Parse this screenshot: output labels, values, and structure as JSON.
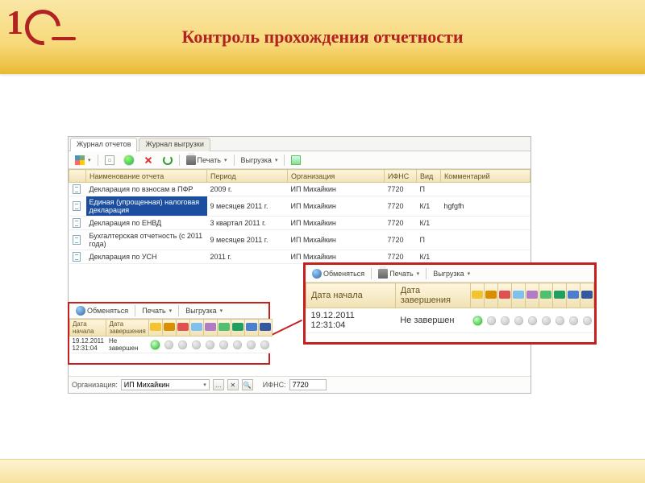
{
  "slide": {
    "title": "Контроль прохождения отчетности"
  },
  "tabs": {
    "reports": "Журнал отчетов",
    "uploads": "Журнал выгрузки"
  },
  "toolbar": {
    "print": "Печать",
    "export": "Выгрузка"
  },
  "grid": {
    "headers": {
      "name": "Наименование отчета",
      "period": "Период",
      "org": "Организация",
      "ifns": "ИФНС",
      "kind": "Вид",
      "comment": "Комментарий"
    },
    "rows": [
      {
        "name": "Декларация по взносам в ПФР",
        "period": "2009 г.",
        "org": "ИП Михайкин",
        "ifns": "7720",
        "kind": "П",
        "comment": ""
      },
      {
        "name": "Единая (упрощенная) налоговая декларация",
        "period": "9 месяцев 2011 г.",
        "org": "ИП Михайкин",
        "ifns": "7720",
        "kind": "К/1",
        "comment": "hgfgfh"
      },
      {
        "name": "Декларация по ЕНВД",
        "period": "3 квартал 2011 г.",
        "org": "ИП Михайкин",
        "ifns": "7720",
        "kind": "К/1",
        "comment": ""
      },
      {
        "name": "Бухгалтерская отчетность (с 2011 года)",
        "period": "9 месяцев 2011 г.",
        "org": "ИП Михайкин",
        "ifns": "7720",
        "kind": "П",
        "comment": ""
      },
      {
        "name": "Декларация по УСН",
        "period": "2011 г.",
        "org": "ИП Михайкин",
        "ifns": "7720",
        "kind": "К/1",
        "comment": ""
      }
    ]
  },
  "statusbar": {
    "org_label": "Организация:",
    "org_value": "ИП Михайкин",
    "ifns_label": "ИФНС:",
    "ifns_value": "7720"
  },
  "exchange": {
    "btn_exchange": "Обменяться",
    "btn_print": "Печать",
    "btn_export": "Выгрузка",
    "headers": {
      "start": "Дата начала",
      "end": "Дата завершения"
    },
    "row": {
      "start": "19.12.2011 12:31:04",
      "end": "Не завершен"
    }
  }
}
